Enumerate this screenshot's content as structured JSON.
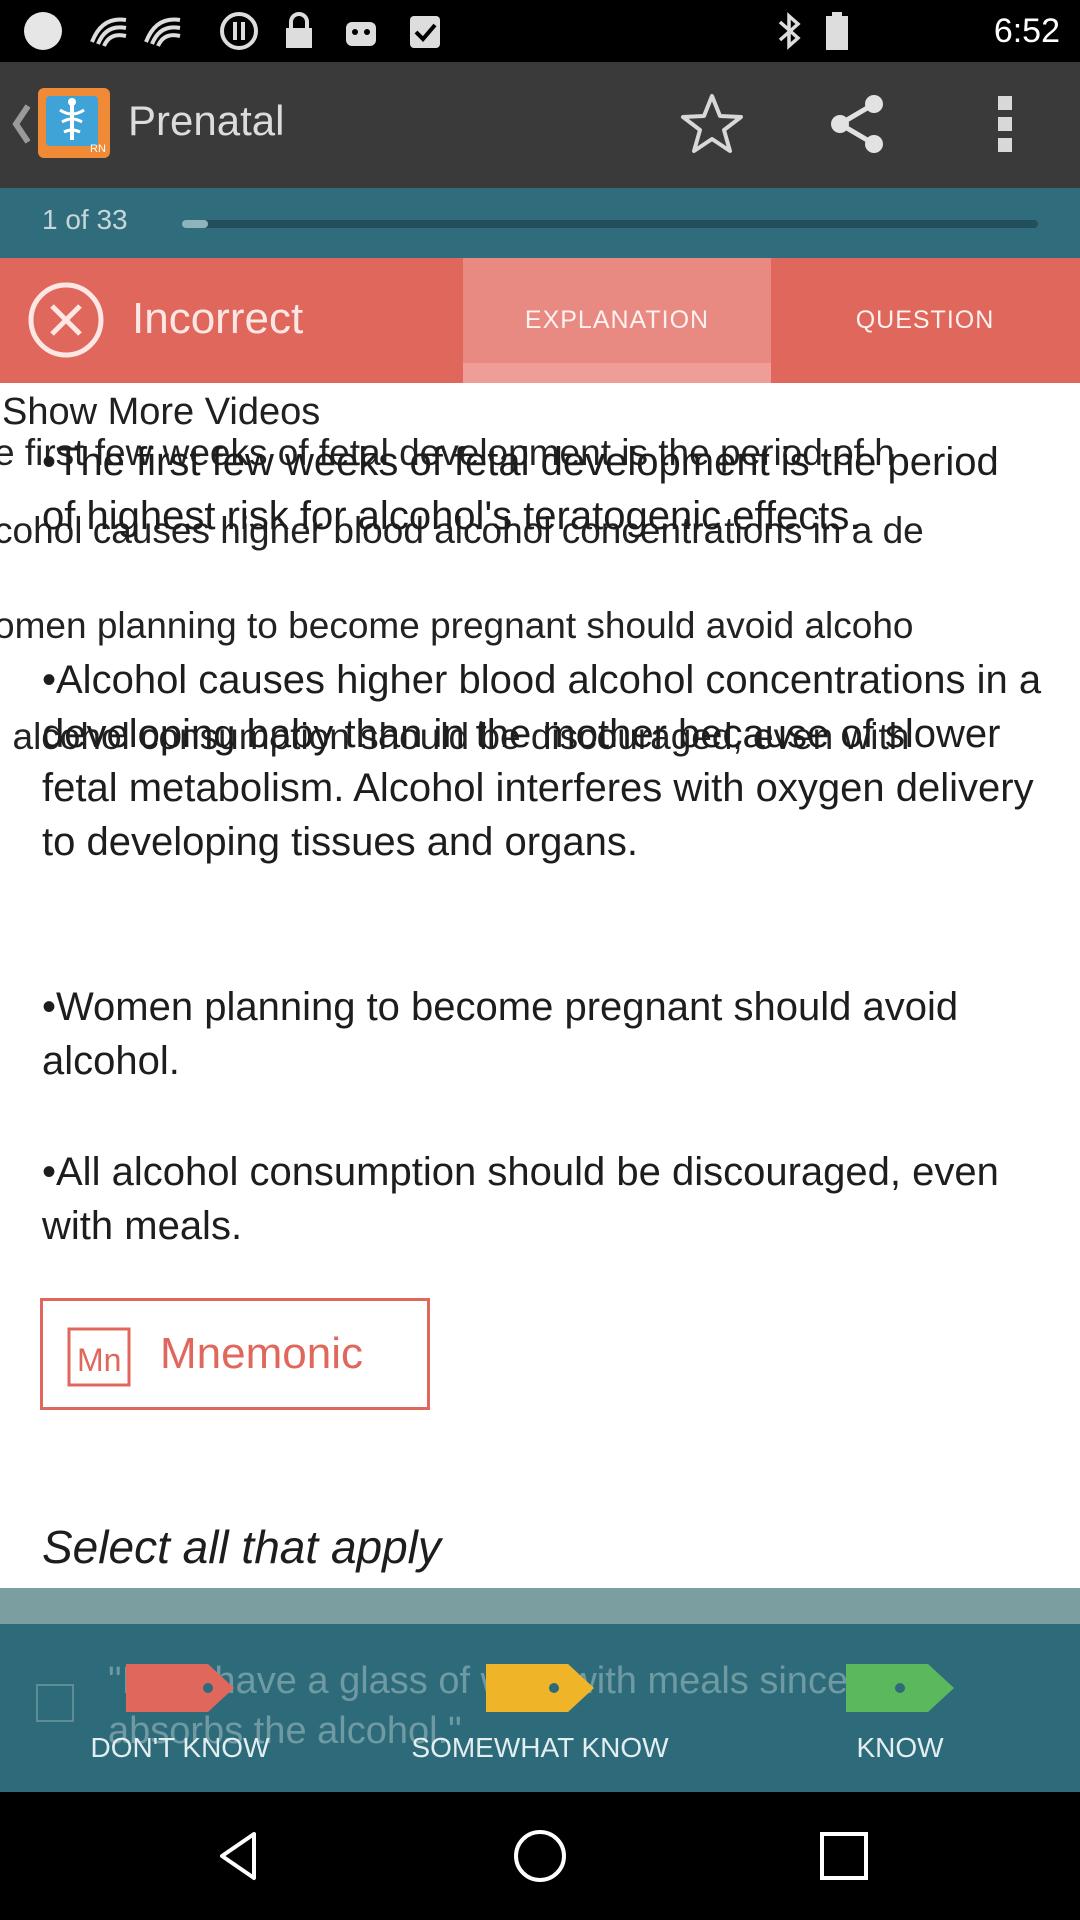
{
  "status_bar": {
    "time": "6:52",
    "icons": [
      "circle-icon",
      "signal-wave-icon",
      "signal-wave-icon",
      "pause-circle-icon",
      "lock-icon",
      "android-icon",
      "clipboard-check-icon",
      "bluetooth-icon",
      "battery-icon"
    ]
  },
  "app_bar": {
    "title": "Prenatal",
    "icons": [
      "back-chevron-icon",
      "app-logo-icon",
      "star-icon",
      "share-icon",
      "overflow-menu-icon"
    ]
  },
  "progress": {
    "label": "1 of 33",
    "fraction": 0.03
  },
  "result": {
    "label": "Incorrect",
    "tabs": [
      "EXPLANATION",
      "QUESTION"
    ],
    "selected_tab": "EXPLANATION",
    "color": "#e0675c"
  },
  "content": {
    "videos_link": "Show More Videos",
    "ghost_lines": [
      "e first few weeks of fetal development is the period of h",
      "cohol causes higher blood alcohol concentrations in a de",
      "omen planning to become pregnant should avoid alcoho",
      "l alcohol consumption should be discouraged, even with"
    ],
    "paragraphs": [
      "•The first few weeks of fetal development is the period of highest risk for alcohol's teratogenic effects.",
      "•Alcohol causes higher blood alcohol concentrations in a developing baby than in the mother because of slower fetal metabolism. Alcohol interferes with oxygen delivery to developing tissues and organs.",
      "•Women planning to become pregnant should avoid alcohol.",
      "•All alcohol consumption should be discouraged, even with meals."
    ],
    "mnemonic": {
      "icon_text": "Mn",
      "label": "Mnemonic"
    },
    "instruction": "Select all that apply"
  },
  "answer_option": {
    "text": "\"I can have a glass of wine with meals since food absorbs the alcohol.\""
  },
  "rating": {
    "buttons": [
      {
        "label": "DON'T KNOW",
        "color": "#e0675c"
      },
      {
        "label": "SOMEWHAT KNOW",
        "color": "#f0b429"
      },
      {
        "label": "KNOW",
        "color": "#5cb85c"
      }
    ]
  },
  "nav_bar": {
    "icons": [
      "back-triangle-icon",
      "home-circle-icon",
      "recents-square-icon"
    ]
  }
}
